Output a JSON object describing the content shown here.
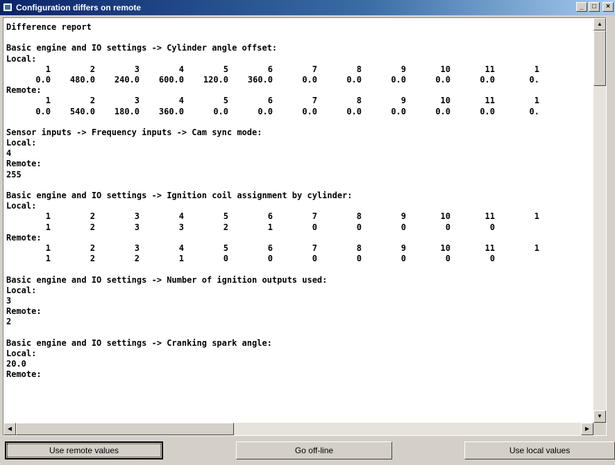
{
  "window": {
    "title": "Configuration differs on remote",
    "controls": {
      "minimize": "_",
      "maximize": "□",
      "close": "×"
    }
  },
  "report": {
    "heading": "Difference report",
    "sections": [
      {
        "title": "Basic engine and IO settings -> Cylinder angle offset:",
        "local_label": "Local:",
        "local_rows": [
          [
            "1",
            "2",
            "3",
            "4",
            "5",
            "6",
            "7",
            "8",
            "9",
            "10",
            "11",
            "1"
          ],
          [
            "0.0",
            "480.0",
            "240.0",
            "600.0",
            "120.0",
            "360.0",
            "0.0",
            "0.0",
            "0.0",
            "0.0",
            "0.0",
            "0."
          ]
        ],
        "remote_label": "Remote:",
        "remote_rows": [
          [
            "1",
            "2",
            "3",
            "4",
            "5",
            "6",
            "7",
            "8",
            "9",
            "10",
            "11",
            "1"
          ],
          [
            "0.0",
            "540.0",
            "180.0",
            "360.0",
            "0.0",
            "0.0",
            "0.0",
            "0.0",
            "0.0",
            "0.0",
            "0.0",
            "0."
          ]
        ]
      },
      {
        "title": "Sensor inputs -> Frequency inputs -> Cam sync mode:",
        "local_label": "Local:",
        "local_value": "4",
        "remote_label": "Remote:",
        "remote_value": "255"
      },
      {
        "title": "Basic engine and IO settings -> Ignition coil assignment by cylinder:",
        "local_label": "Local:",
        "local_rows": [
          [
            "1",
            "2",
            "3",
            "4",
            "5",
            "6",
            "7",
            "8",
            "9",
            "10",
            "11",
            "1"
          ],
          [
            "1",
            "2",
            "3",
            "3",
            "2",
            "1",
            "0",
            "0",
            "0",
            "0",
            "0",
            ""
          ]
        ],
        "remote_label": "Remote:",
        "remote_rows": [
          [
            "1",
            "2",
            "3",
            "4",
            "5",
            "6",
            "7",
            "8",
            "9",
            "10",
            "11",
            "1"
          ],
          [
            "1",
            "2",
            "2",
            "1",
            "0",
            "0",
            "0",
            "0",
            "0",
            "0",
            "0",
            ""
          ]
        ]
      },
      {
        "title": "Basic engine and IO settings -> Number of ignition outputs used:",
        "local_label": "Local:",
        "local_value": "3",
        "remote_label": "Remote:",
        "remote_value": "2"
      },
      {
        "title": "Basic engine and IO settings -> Cranking spark angle:",
        "local_label": "Local:",
        "local_value": "20.0",
        "remote_label": "Remote:"
      }
    ]
  },
  "scrollbars": {
    "up_arrow": "▲",
    "down_arrow": "▼",
    "left_arrow": "◀",
    "right_arrow": "▶"
  },
  "buttons": {
    "use_remote": "Use remote values",
    "go_offline": "Go off-line",
    "use_local": "Use local values"
  }
}
